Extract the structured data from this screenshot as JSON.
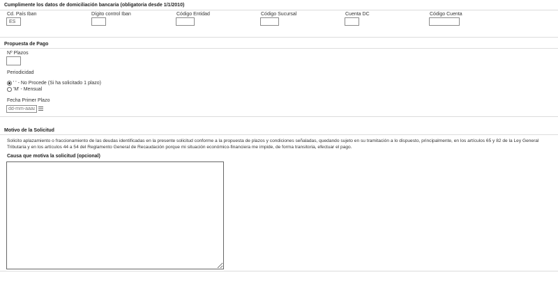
{
  "bank": {
    "title": "Cumplimente los datos de domiciliación bancaria (obligatoria desde 1/1/2010)",
    "fields": [
      {
        "label": "Cd. País Iban",
        "value": "ES"
      },
      {
        "label": "Dígito control Iban",
        "value": ""
      },
      {
        "label": "Código Entidad",
        "value": ""
      },
      {
        "label": "Código Sucursal",
        "value": ""
      },
      {
        "label": "Cuenta DC",
        "value": ""
      },
      {
        "label": "Código Cuenta",
        "value": ""
      }
    ]
  },
  "payment": {
    "title": "Propuesta de Pago",
    "plazos_label": "Nº Plazos",
    "plazos_value": "",
    "periodicidad_label": "Periodicidad",
    "options": [
      {
        "label": "' ' - No Procede (Si ha solicitado 1 plazo)",
        "checked": true
      },
      {
        "label": "'M' - Mensual",
        "checked": false
      }
    ],
    "fecha_label": "Fecha Primer Plazo",
    "fecha_placeholder": "dd-mm-aaaa"
  },
  "motivo": {
    "title": "Motivo de la Solicitud",
    "text": "Solicito aplazamiento o fraccionamiento de las deudas identificadas en la presente solicitud conforme a la propuesta de plazos y condiciones señaladas, quedando sujeto en su tramitación a lo dispuesto, principalmente, en los artículos 65 y 82 de la Ley General Tributaria y en los artículos 44 a 54 del Reglamento General de Recaudación porque mi situación económico-financiera me impide, de forma transitoria, efectuar el pago.",
    "causa_label": "Causa que motiva la solicitud (opcional)",
    "causa_value": ""
  }
}
